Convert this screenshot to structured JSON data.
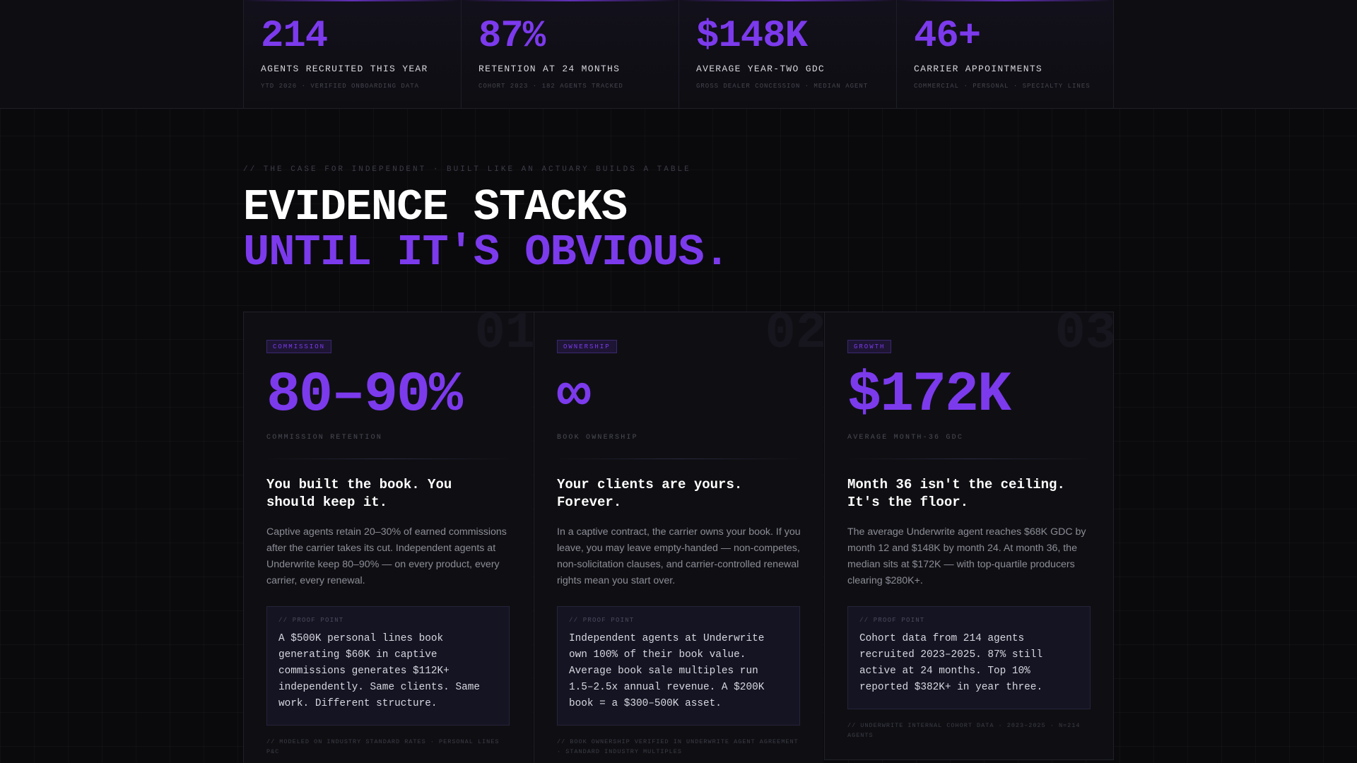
{
  "stats": [
    {
      "value": "214",
      "label": "AGENTS RECRUITED THIS YEAR",
      "sub": "YTD 2026 · VERIFIED ONBOARDING DATA"
    },
    {
      "value": "87%",
      "label": "RETENTION AT 24 MONTHS",
      "sub": "COHORT 2023 · 182 AGENTS TRACKED"
    },
    {
      "value": "$148K",
      "label": "AVERAGE YEAR-TWO GDC",
      "sub": "GROSS DEALER CONCESSION · MEDIAN AGENT"
    },
    {
      "value": "46+",
      "label": "CARRIER APPOINTMENTS",
      "sub": "COMMERCIAL · PERSONAL · SPECIALTY LINES"
    }
  ],
  "section": {
    "eyebrow": "// THE CASE FOR INDEPENDENT · BUILT LIKE AN ACTUARY BUILDS A TABLE",
    "headline_line1": "EVIDENCE STACKS",
    "headline_line2": "UNTIL IT'S OBVIOUS."
  },
  "cards": [
    {
      "num": "01",
      "badge": "COMMISSION",
      "big": "80–90%",
      "big_label": "COMMISSION RETENTION",
      "title": "You built the book. You should keep it.",
      "body": "Captive agents retain 20–30% of earned commissions after the carrier takes its cut. Independent agents at Underwrite keep 80–90% — on every product, every carrier, every renewal.",
      "proof_label": "// PROOF POINT",
      "proof_text": "A $500K personal lines book generating $60K in captive commissions generates $112K+ independently. Same clients. Same work. Different structure.",
      "footnote": "// MODELED ON INDUSTRY STANDARD RATES · PERSONAL LINES P&C"
    },
    {
      "num": "02",
      "badge": "OWNERSHIP",
      "big": "∞",
      "big_label": "BOOK OWNERSHIP",
      "title": "Your clients are yours. Forever.",
      "body": "In a captive contract, the carrier owns your book. If you leave, you may leave empty-handed — non-competes, non-solicitation clauses, and carrier-controlled renewal rights mean you start over.",
      "proof_label": "// PROOF POINT",
      "proof_text": "Independent agents at Underwrite own 100% of their book value. Average book sale multiples run 1.5–2.5x annual revenue. A $200K book = a $300–500K asset.",
      "footnote": "// BOOK OWNERSHIP VERIFIED IN UNDERWRITE AGENT AGREEMENT · STANDARD INDUSTRY MULTIPLES"
    },
    {
      "num": "03",
      "badge": "GROWTH",
      "big": "$172K",
      "big_label": "AVERAGE MONTH-36 GDC",
      "title": "Month 36 isn't the ceiling. It's the floor.",
      "body": "The average Underwrite agent reaches $68K GDC by month 12 and $148K by month 24. At month 36, the median sits at $172K — with top-quartile producers clearing $280K+.",
      "proof_label": "// PROOF POINT",
      "proof_text": "Cohort data from 214 agents recruited 2023–2025. 87% still active at 24 months. Top 10% reported $382K+ in year three.",
      "footnote": "// UNDERWRITE INTERNAL COHORT DATA · 2023–2025 · N=214 AGENTS"
    }
  ]
}
